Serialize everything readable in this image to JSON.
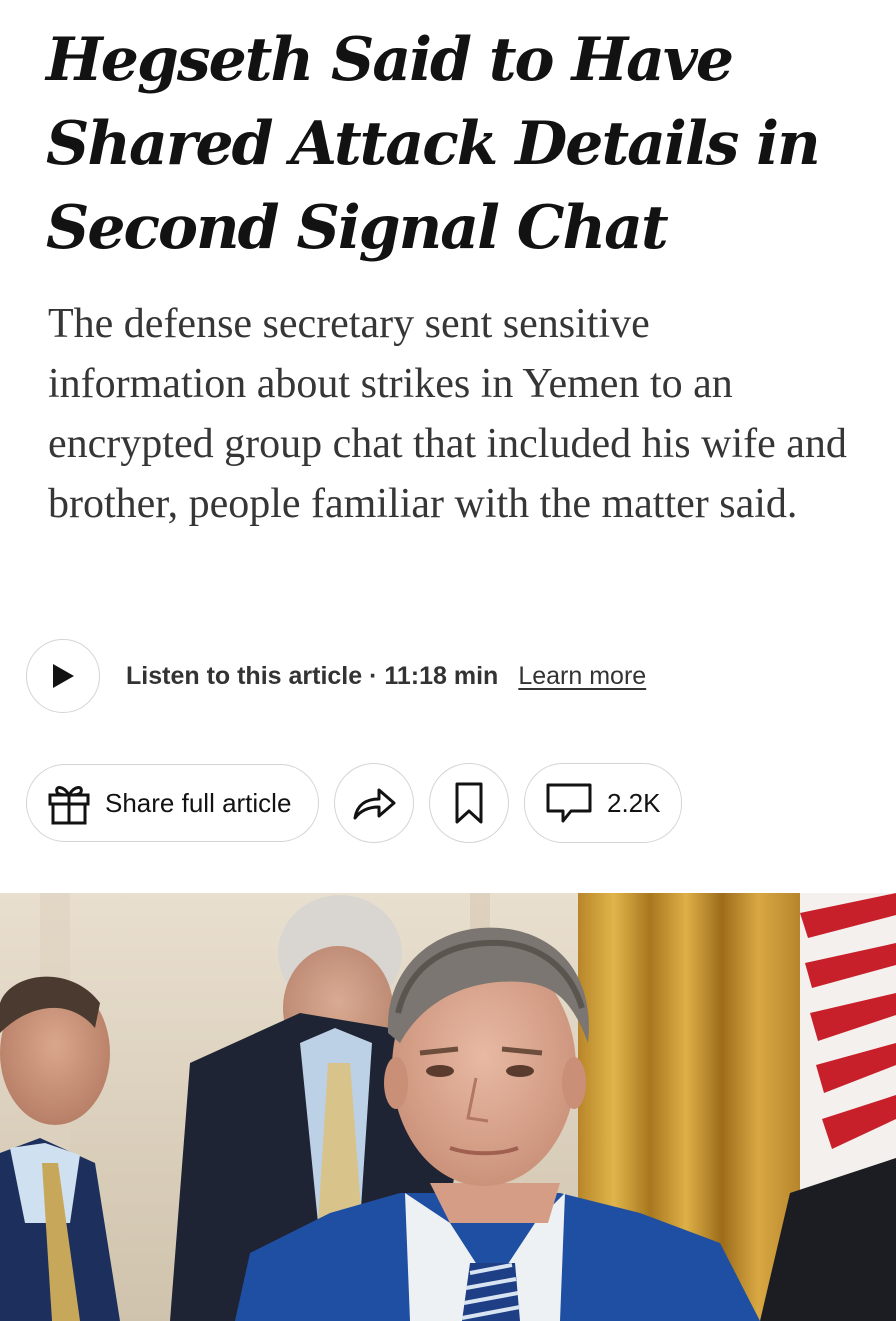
{
  "article": {
    "headline": "Hegseth Said to Have Shared Attack Details in Second Signal Chat",
    "summary": "The defense secretary sent sensitive information about strikes in Yemen to an encrypted group chat that included his wife and brother, people familiar with the matter said."
  },
  "audio": {
    "listen_label": "Listen to this article · 11:18 min",
    "learn_more": "Learn more",
    "play_icon": "play-icon"
  },
  "actions": {
    "share_label": "Share full article",
    "gift_icon": "gift-icon",
    "share_icon": "share-arrow-icon",
    "bookmark_icon": "bookmark-icon",
    "comment_icon": "comment-icon",
    "comment_count": "2.2K"
  },
  "colors": {
    "text": "#121212",
    "summary_text": "#363636",
    "border": "#d4d4d4",
    "background": "#ffffff"
  }
}
